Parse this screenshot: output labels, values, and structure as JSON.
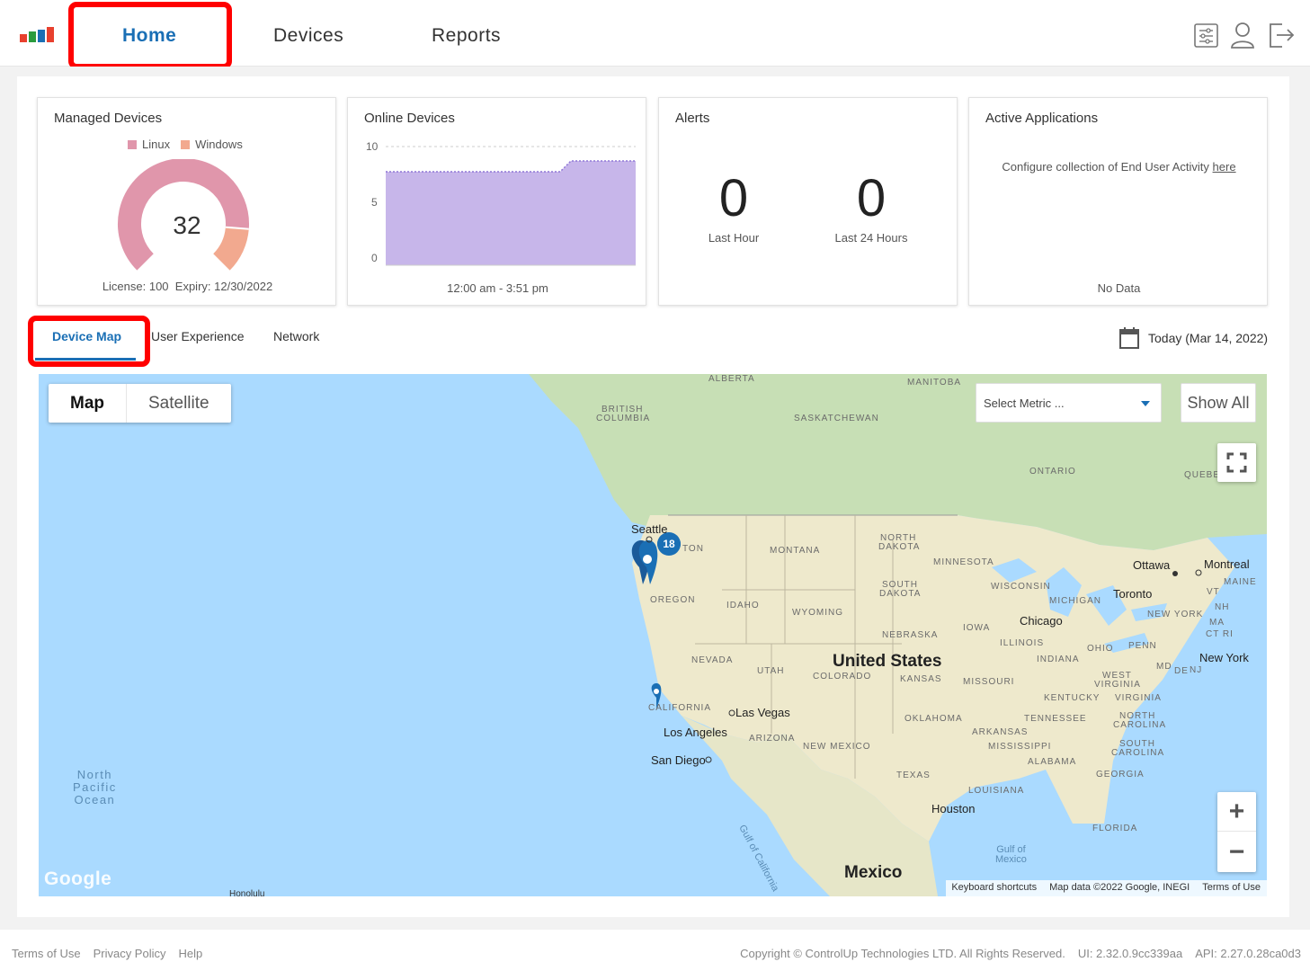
{
  "header": {
    "nav": {
      "home": "Home",
      "devices": "Devices",
      "reports": "Reports"
    }
  },
  "cards": {
    "managed": {
      "title": "Managed Devices",
      "legend_linux": "Linux",
      "legend_windows": "Windows",
      "total": "32",
      "linux_count_share": 0.85,
      "license": "License: 100",
      "expiry": "Expiry: 12/30/2022"
    },
    "online": {
      "title": "Online Devices",
      "ticks": [
        "10",
        "5",
        "0"
      ],
      "range": "12:00 am - 3:51 pm"
    },
    "alerts": {
      "title": "Alerts",
      "last_hour_value": "0",
      "last_hour_label": "Last Hour",
      "last_24_value": "0",
      "last_24_label": "Last 24 Hours"
    },
    "apps": {
      "title": "Active Applications",
      "text": "Configure collection of End User Activity",
      "link": "here",
      "no_data": "No Data"
    }
  },
  "tabs": {
    "device_map": "Device Map",
    "user_experience": "User Experience",
    "network": "Network"
  },
  "date_label": "Today (Mar 14, 2022)",
  "map": {
    "type_map": "Map",
    "type_satellite": "Satellite",
    "metric_placeholder": "Select Metric ...",
    "show_all": "Show All",
    "cluster_count": "18",
    "google": "Google",
    "attribution": [
      "Keyboard shortcuts",
      "Map data ©2022 Google, INEGI",
      "Terms of Use"
    ],
    "labels": {
      "alberta": "ALBERTA",
      "manitoba": "MANITOBA",
      "british_columbia_1": "BRITISH",
      "british_columbia_2": "COLUMBIA",
      "saskatchewan": "SASKATCHEWAN",
      "ontario": "ONTARIO",
      "quebec": "QUEBE",
      "seattle": "Seattle",
      "washington": "TON",
      "montana": "MONTANA",
      "north_dakota_1": "NORTH",
      "north_dakota_2": "DAKOTA",
      "minnesota": "MINNESOTA",
      "ottawa": "Ottawa",
      "montreal": "Montreal",
      "maine": "MAINE",
      "vt": "VT",
      "nh": "NH",
      "ma": "MA",
      "ct_ri": "CT RI",
      "toronto": "Toronto",
      "oregon": "OREGON",
      "idaho": "IDAHO",
      "south_dakota_1": "SOUTH",
      "south_dakota_2": "DAKOTA",
      "wisconsin": "WISCONSIN",
      "michigan": "MICHIGAN",
      "new_york_state": "NEW YORK",
      "wyoming": "WYOMING",
      "chicago": "Chicago",
      "iowa": "IOWA",
      "nebraska": "NEBRASKA",
      "illinois": "ILLINOIS",
      "ohio": "OHIO",
      "penn": "PENN",
      "new_york": "New York",
      "nevada": "NEVADA",
      "utah": "UTAH",
      "united_states": "United States",
      "colorado": "COLORADO",
      "kansas": "KANSAS",
      "missouri": "MISSOURI",
      "indiana": "INDIANA",
      "md": "MD",
      "de": "DE",
      "nj": "NJ",
      "west_virginia_1": "WEST",
      "west_virginia_2": "VIRGINIA",
      "virginia": "VIRGINIA",
      "kentucky": "KENTUCKY",
      "california": "CALIFORNIA",
      "las_vegas": "Las Vegas",
      "oklahoma": "OKLAHOMA",
      "tennessee": "TENNESSEE",
      "north_carolina_1": "NORTH",
      "north_carolina_2": "CAROLINA",
      "los_angeles": "Los Angeles",
      "arizona": "ARIZONA",
      "new_mexico": "NEW MEXICO",
      "arkansas": "ARKANSAS",
      "south_carolina_1": "SOUTH",
      "south_carolina_2": "CAROLINA",
      "mississippi": "MISSISSIPPI",
      "alabama": "ALABAMA",
      "san_diego": "San Diego",
      "georgia": "GEORGIA",
      "texas": "TEXAS",
      "louisiana": "LOUISIANA",
      "houston": "Houston",
      "florida": "FLORIDA",
      "north_pacific_1": "North",
      "north_pacific_2": "Pacific",
      "north_pacific_3": "Ocean",
      "gulf_california": "Gulf of California",
      "gulf_mexico_1": "Gulf of",
      "gulf_mexico_2": "Mexico",
      "mexico": "Mexico",
      "honolulu": "Honolulu"
    }
  },
  "footer": {
    "terms": "Terms of Use",
    "privacy": "Privacy Policy",
    "help": "Help",
    "copyright": "Copyright © ControlUp Technologies LTD. All Rights Reserved.",
    "ui_version": "UI: 2.32.0.9cc339aa",
    "api_version": "API: 2.27.0.28ca0d3"
  },
  "colors": {
    "accent": "#1a6fb5",
    "linux": "#e096ab",
    "windows": "#f2a98f",
    "online_fill": "#c7b6ea",
    "highlight": "#ff0000"
  }
}
